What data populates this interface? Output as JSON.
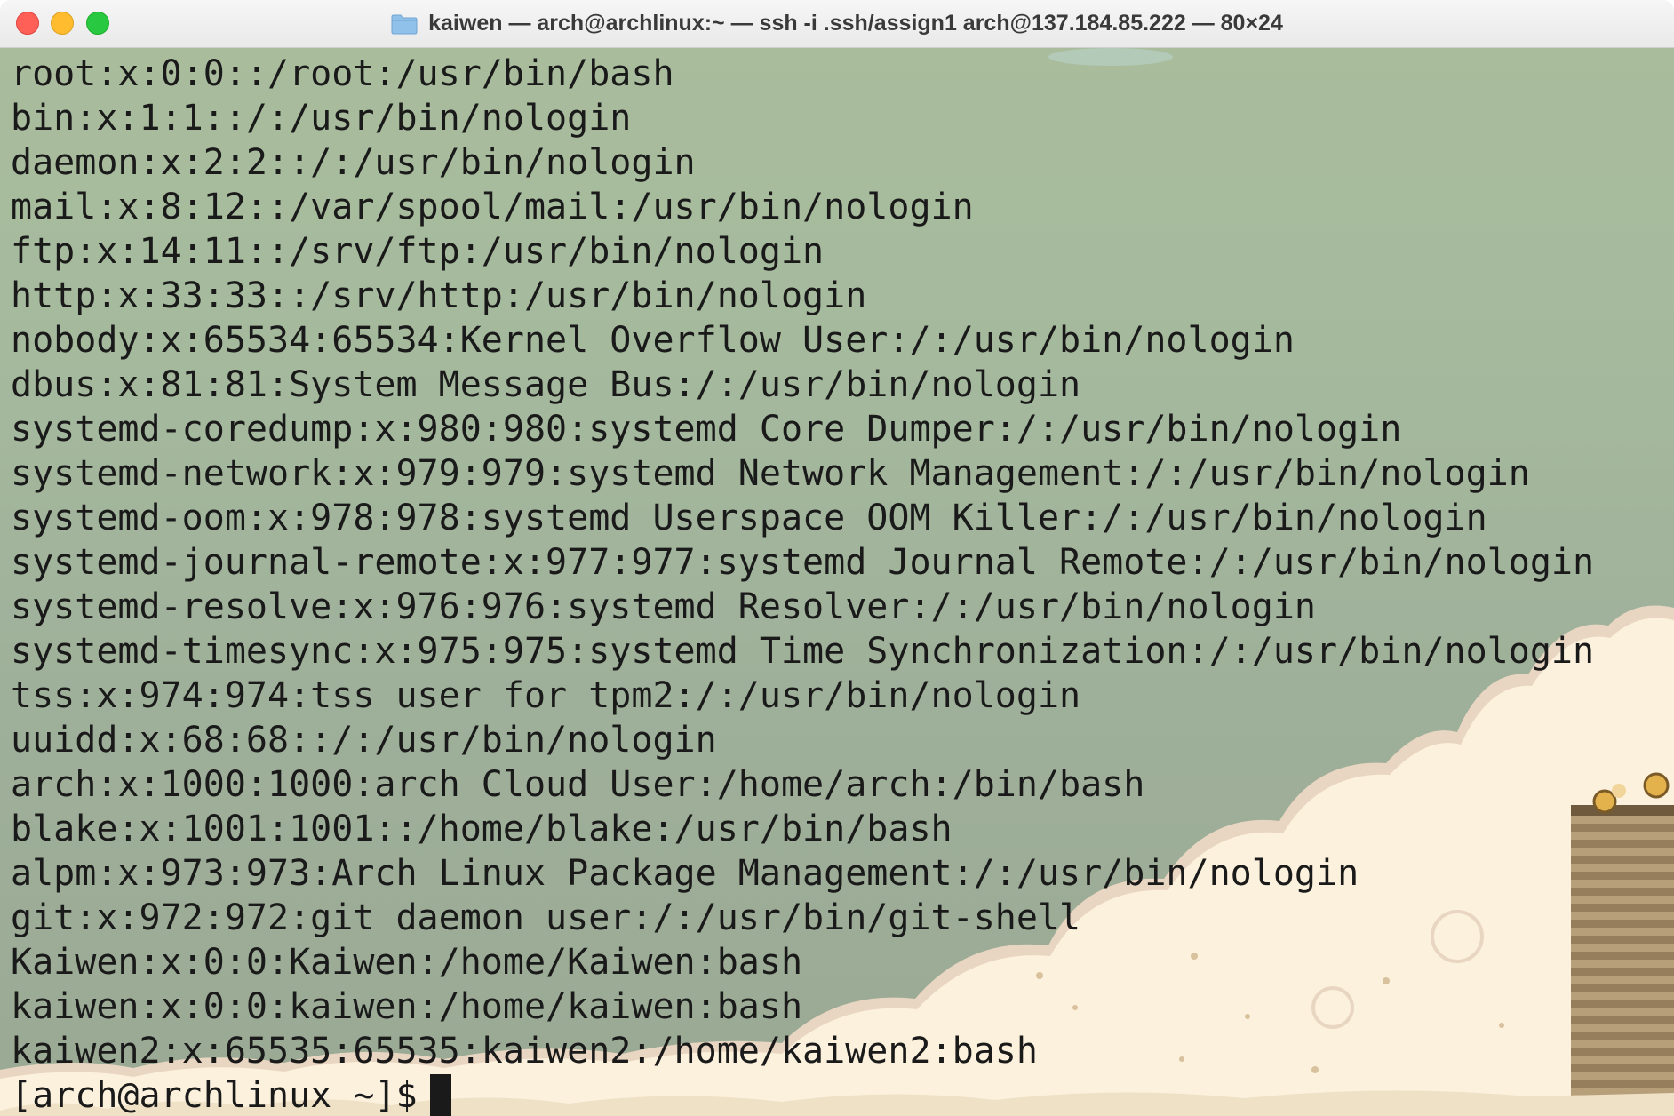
{
  "window": {
    "title": "kaiwen — arch@archlinux:~ — ssh -i .ssh/assign1 arch@137.184.85.222 — 80×24",
    "title_icon": "folder-icon",
    "controls": {
      "close": "#fe5f57",
      "minimize": "#febc2e",
      "maximize": "#28c840"
    }
  },
  "terminal": {
    "lines": [
      "root:x:0:0::/root:/usr/bin/bash",
      "bin:x:1:1::/:/usr/bin/nologin",
      "daemon:x:2:2::/:/usr/bin/nologin",
      "mail:x:8:12::/var/spool/mail:/usr/bin/nologin",
      "ftp:x:14:11::/srv/ftp:/usr/bin/nologin",
      "http:x:33:33::/srv/http:/usr/bin/nologin",
      "nobody:x:65534:65534:Kernel Overflow User:/:/usr/bin/nologin",
      "dbus:x:81:81:System Message Bus:/:/usr/bin/nologin",
      "systemd-coredump:x:980:980:systemd Core Dumper:/:/usr/bin/nologin",
      "systemd-network:x:979:979:systemd Network Management:/:/usr/bin/nologin",
      "systemd-oom:x:978:978:systemd Userspace OOM Killer:/:/usr/bin/nologin",
      "systemd-journal-remote:x:977:977:systemd Journal Remote:/:/usr/bin/nologin",
      "systemd-resolve:x:976:976:systemd Resolver:/:/usr/bin/nologin",
      "systemd-timesync:x:975:975:systemd Time Synchronization:/:/usr/bin/nologin",
      "tss:x:974:974:tss user for tpm2:/:/usr/bin/nologin",
      "uuidd:x:68:68::/:/usr/bin/nologin",
      "arch:x:1000:1000:arch Cloud User:/home/arch:/bin/bash",
      "blake:x:1001:1001::/home/blake:/usr/bin/bash",
      "alpm:x:973:973:Arch Linux Package Management:/:/usr/bin/nologin",
      "git:x:972:972:git daemon user:/:/usr/bin/git-shell",
      "Kaiwen:x:0:0:Kaiwen:/home/Kaiwen:bash",
      "kaiwen:x:0:0:kaiwen:/home/kaiwen:bash",
      "kaiwen2:x:65535:65535:kaiwen2:/home/kaiwen2:bash"
    ],
    "prompt": "[arch@archlinux ~]$",
    "colors": {
      "text": "#1a1a1a",
      "background_top": "#a9bd9d",
      "cloud": "#fbf1dc"
    }
  }
}
